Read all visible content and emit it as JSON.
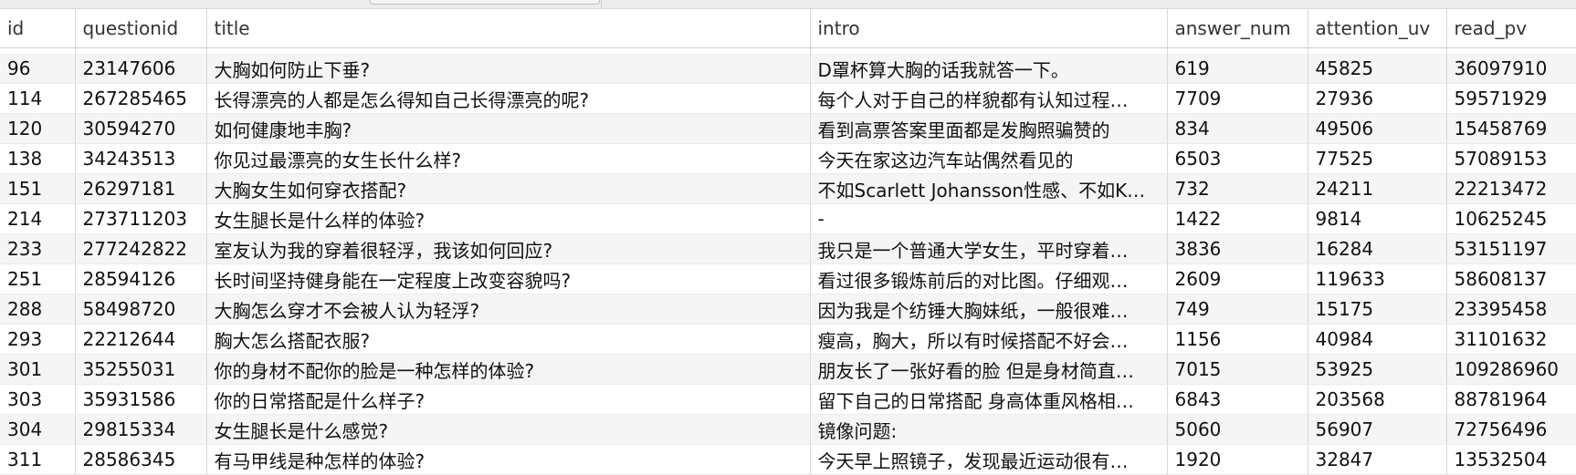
{
  "table": {
    "columns": [
      "id",
      "questionid",
      "title",
      "intro",
      "answer_num",
      "attention_uv",
      "read_pv"
    ],
    "rows": [
      [
        "96",
        "23147606",
        "大胸如何防止下垂?",
        "D罩杯算大胸的话我就答一下。",
        "619",
        "45825",
        "36097910"
      ],
      [
        "114",
        "267285465",
        "长得漂亮的人都是怎么得知自己长得漂亮的呢?",
        "每个人对于自己的样貌都有认知过程…",
        "7709",
        "27936",
        "59571929"
      ],
      [
        "120",
        "30594270",
        "如何健康地丰胸?",
        "看到高票答案里面都是发胸照骗赞的",
        "834",
        "49506",
        "15458769"
      ],
      [
        "138",
        "34243513",
        "你见过最漂亮的女生长什么样?",
        "今天在家这边汽车站偶然看见的",
        "6503",
        "77525",
        "57089153"
      ],
      [
        "151",
        "26297181",
        "大胸女生如何穿衣搭配?",
        "不如Scarlett Johansson性感、不如K…",
        "732",
        "24211",
        "22213472"
      ],
      [
        "214",
        "273711203",
        "女生腿长是什么样的体验?",
        "-",
        "1422",
        "9814",
        "10625245"
      ],
      [
        "233",
        "277242822",
        "室友认为我的穿着很轻浮，我该如何回应?",
        "我只是一个普通大学女生，平时穿着…",
        "3836",
        "16284",
        "53151197"
      ],
      [
        "251",
        "28594126",
        "长时间坚持健身能在一定程度上改变容貌吗?",
        "看过很多锻炼前后的对比图。仔细观…",
        "2609",
        "119633",
        "58608137"
      ],
      [
        "288",
        "58498720",
        "大胸怎么穿才不会被人认为轻浮?",
        "因为我是个纺锤大胸妹纸，一般很难…",
        "749",
        "15175",
        "23395458"
      ],
      [
        "293",
        "22212644",
        "胸大怎么搭配衣服?",
        "瘦高，胸大，所以有时候搭配不好会…",
        "1156",
        "40984",
        "31101632"
      ],
      [
        "301",
        "35255031",
        "你的身材不配你的脸是一种怎样的体验?",
        "朋友长了一张好看的脸 但是身材简直…",
        "7015",
        "53925",
        "109286960"
      ],
      [
        "303",
        "35931586",
        "你的日常搭配是什么样子?",
        "留下自己的日常搭配 身高体重风格相…",
        "6843",
        "203568",
        "88781964"
      ],
      [
        "304",
        "29815334",
        "女生腿长是什么感觉?",
        "镜像问题:",
        "5060",
        "56907",
        "72756496"
      ],
      [
        "311",
        "28586345",
        "有马甲线是种怎样的体验?",
        "今天早上照镜子，发现最近运动很有…",
        "1920",
        "32847",
        "13532504"
      ]
    ]
  }
}
